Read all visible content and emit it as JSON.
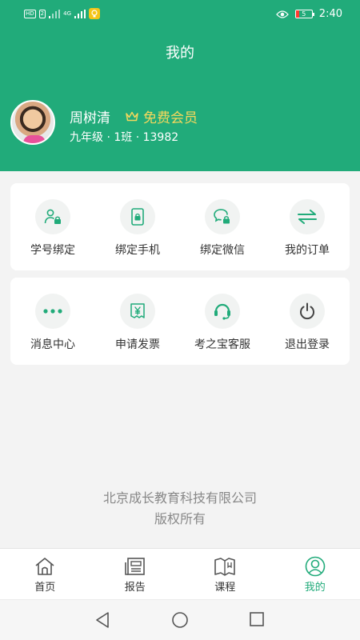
{
  "status_bar": {
    "network": "HD",
    "network_sub": "2",
    "signal_tech": "4G",
    "battery_level": "5",
    "time": "2:40"
  },
  "header": {
    "title": "我的"
  },
  "user": {
    "name": "周树清",
    "membership": "免费会员",
    "meta": "九年级 · 1班 · 13982"
  },
  "menu_groups": [
    {
      "items": [
        {
          "label": "学号绑定",
          "icon": "student-id-lock-icon"
        },
        {
          "label": "绑定手机",
          "icon": "phone-lock-icon"
        },
        {
          "label": "绑定微信",
          "icon": "wechat-lock-icon"
        },
        {
          "label": "我的订单",
          "icon": "transfer-arrows-icon"
        }
      ]
    },
    {
      "items": [
        {
          "label": "消息中心",
          "icon": "more-dots-icon"
        },
        {
          "label": "申请发票",
          "icon": "invoice-yuan-icon"
        },
        {
          "label": "考之宝客服",
          "icon": "headset-icon"
        },
        {
          "label": "退出登录",
          "icon": "power-icon"
        }
      ]
    }
  ],
  "footer": {
    "company": "北京成长教育科技有限公司",
    "rights": "版权所有"
  },
  "tabbar": {
    "tabs": [
      {
        "label": "首页",
        "icon": "home-icon"
      },
      {
        "label": "报告",
        "icon": "report-icon"
      },
      {
        "label": "课程",
        "icon": "book-icon"
      },
      {
        "label": "我的",
        "icon": "profile-icon",
        "active": true
      }
    ]
  },
  "colors": {
    "brand": "#21ab7a",
    "vip_gold": "#f6d85c",
    "icon_bg": "#f1f3f2"
  }
}
